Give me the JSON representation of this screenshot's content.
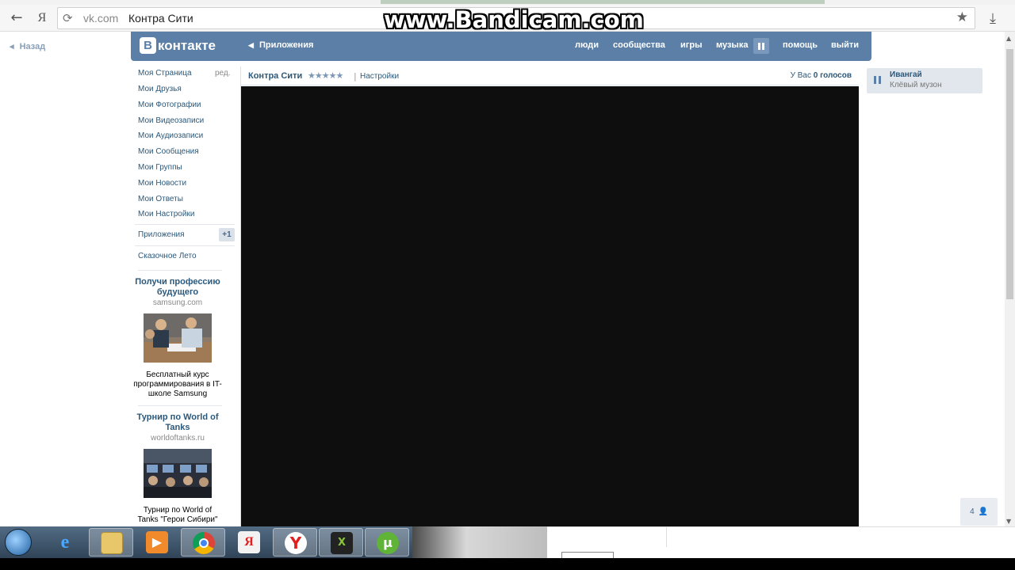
{
  "browser": {
    "domain": "vk.com",
    "title": "Контра Сити",
    "back_icon": "arrow-left",
    "yandex_label": "Я",
    "reload_icon": "reload",
    "star_icon": "star",
    "download_icon": "download"
  },
  "watermark": "www.Bandicam.com",
  "page": {
    "back_label": "Назад"
  },
  "header": {
    "logo_letter": "В",
    "logo_text": "контакте",
    "apps_label": "Приложения",
    "nav": [
      "люди",
      "сообщества",
      "игры",
      "музыка",
      "помощь",
      "выйти"
    ]
  },
  "sidebar": {
    "edit_label": "ред.",
    "items": [
      "Моя Страница",
      "Мои Друзья",
      "Мои Фотографии",
      "Мои Видеозаписи",
      "Мои Аудиозаписи",
      "Мои Сообщения",
      "Мои Группы",
      "Мои Новости",
      "Мои Ответы",
      "Мои Настройки"
    ],
    "apps_item": "Приложения",
    "apps_badge": "+1",
    "extra_item": "Сказочное Лето"
  },
  "ads": [
    {
      "title": "Получи профессию будущего",
      "domain": "samsung.com",
      "description": "Бесплатный курс программирования в IT-школе Samsung"
    },
    {
      "title": "Турнир по World of Tanks",
      "domain": "worldoftanks.ru",
      "description": "Турнир по World of Tanks \"Герои Сибири\""
    }
  ],
  "app": {
    "name": "Контра Сити",
    "rating_stars": "★★★★★",
    "separator": "|",
    "settings_label": "Настройки",
    "votes_prefix": "У Вас",
    "votes_value": "0 голосов"
  },
  "player": {
    "artist": "Ивангай",
    "track": "Клёвый музон"
  },
  "friends_online": {
    "count": "4"
  },
  "taskbar": {
    "icons": [
      "windows-start",
      "internet-explorer",
      "file-explorer",
      "media-player",
      "chrome",
      "yandex",
      "yandex-browser",
      "xampp",
      "utorrent"
    ],
    "yandex_letter": "Я",
    "utorrent_letter": "µ"
  },
  "colors": {
    "vk_blue": "#5b7fa6",
    "link": "#2b587a",
    "app_bg": "#0e0e0e"
  }
}
